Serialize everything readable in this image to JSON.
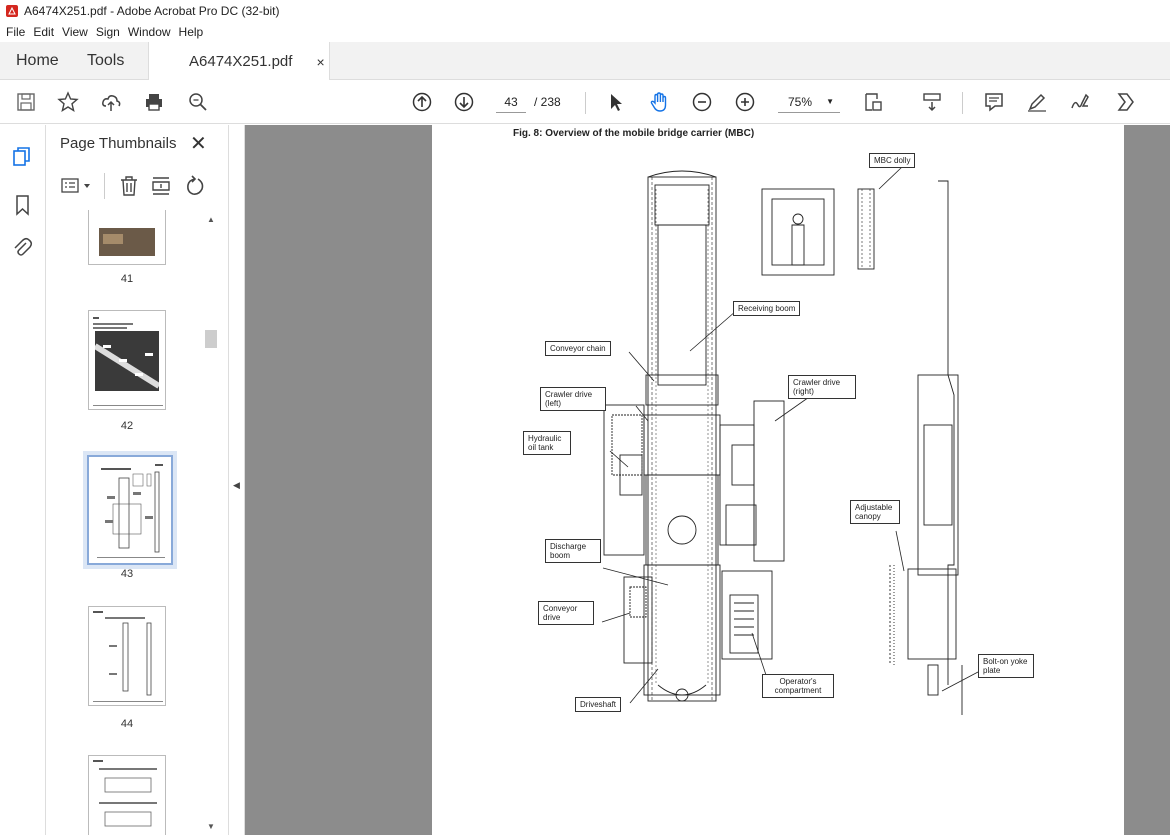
{
  "window": {
    "title": "A6474X251.pdf - Adobe Acrobat Pro DC (32-bit)"
  },
  "menu": [
    "File",
    "Edit",
    "View",
    "Sign",
    "Window",
    "Help"
  ],
  "tabs": {
    "home": "Home",
    "tools": "Tools",
    "document": "A6474X251.pdf",
    "close": "×"
  },
  "toolbar": {
    "page_current": "43",
    "page_total": "/ 238",
    "zoom": "75%"
  },
  "panel": {
    "title": "Page Thumbnails",
    "close": "✕"
  },
  "thumbnails": [
    {
      "label": "41"
    },
    {
      "label": "42"
    },
    {
      "label": "43",
      "selected": true
    },
    {
      "label": "44"
    }
  ],
  "document": {
    "figure_title": "Fig. 8: Overview of the mobile bridge carrier (MBC)",
    "callouts": {
      "mbc_dolly": "MBC dolly",
      "receiving_boom": "Receiving boom",
      "conveyor_chain": "Conveyor chain",
      "crawler_left": "Crawler drive (left)",
      "crawler_right": "Crawler drive (right)",
      "hydraulic_tank": "Hydraulic oil tank",
      "adjustable_canopy": "Adjustable canopy",
      "discharge_boom": "Discharge boom",
      "conveyor_drive": "Conveyor drive",
      "driveshaft": "Driveshaft",
      "operator_compartment": "Operator's compartment",
      "yoke_plate": "Bolt-on yoke plate"
    }
  },
  "colors": {
    "accent": "#1473e6",
    "viewer_bg": "#8c8c8c",
    "selected_thumb": "#88a9d9"
  }
}
